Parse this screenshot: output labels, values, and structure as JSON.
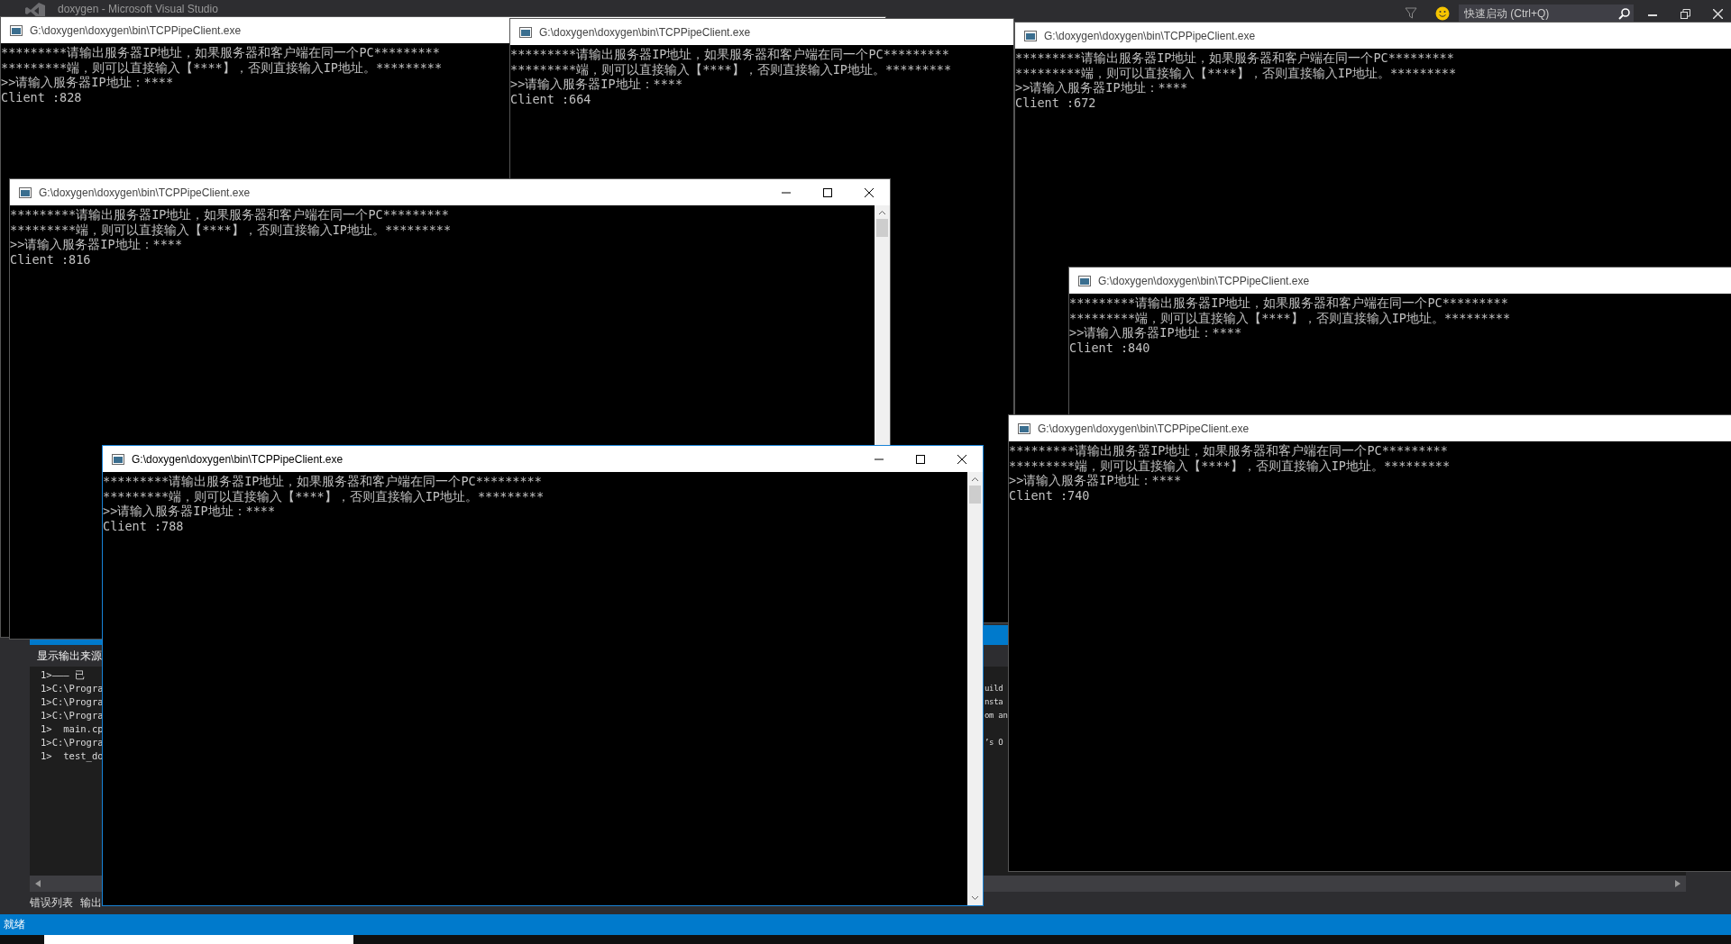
{
  "ide": {
    "title": "doxygen - Microsoft Visual Studio",
    "quick_launch": {
      "placeholder": "快速启动 (Ctrl+Q)"
    },
    "output_pane": {
      "header": "显示输出来源",
      "lines": [
        {
          "left": "1>——— 已"
        },
        {
          "left": "1>C:\\Progra",
          "right": "uild"
        },
        {
          "left": "1>C:\\Progra",
          "right": "nsta"
        },
        {
          "left": "1>C:\\Progra",
          "right": "om an"
        },
        {
          "left": "1>  main.cp"
        },
        {
          "left": "1>C:\\Progra",
          "right": "’s O"
        },
        {
          "left": "1>  test_do"
        }
      ]
    },
    "bottom_tabs": [
      "错误列表",
      "输出"
    ],
    "status_bar": "就绪"
  },
  "console_windows": [
    {
      "title": "G:\\doxygen\\doxygen\\bin\\TCPPipeClient.exe",
      "active": false,
      "lines": [
        "*********请输出服务器IP地址，如果服务器和客户端在同一个PC*********",
        "*********端，则可以直接输入【****】，否则直接输入IP地址。*********",
        ">>请输入服务器IP地址：****",
        "Client :828"
      ]
    },
    {
      "title": "G:\\doxygen\\doxygen\\bin\\TCPPipeClient.exe",
      "active": false,
      "lines": [
        "*********请输出服务器IP地址，如果服务器和客户端在同一个PC*********",
        "*********端，则可以直接输入【****】，否则直接输入IP地址。*********",
        ">>请输入服务器IP地址：****",
        "Client :664"
      ]
    },
    {
      "title": "G:\\doxygen\\doxygen\\bin\\TCPPipeClient.exe",
      "active": false,
      "lines": [
        "*********请输出服务器IP地址，如果服务器和客户端在同一个PC*********",
        "*********端，则可以直接输入【****】，否则直接输入IP地址。*********",
        ">>请输入服务器IP地址：****",
        "Client :672"
      ]
    },
    {
      "title": "G:\\doxygen\\doxygen\\bin\\TCPPipeClient.exe",
      "active": false,
      "lines": [
        "*********请输出服务器IP地址，如果服务器和客户端在同一个PC*********",
        "*********端，则可以直接输入【****】，否则直接输入IP地址。*********",
        ">>请输入服务器IP地址：****",
        "Client :816"
      ]
    },
    {
      "title": "G:\\doxygen\\doxygen\\bin\\TCPPipeClient.exe",
      "active": false,
      "lines": [
        "*********请输出服务器IP地址，如果服务器和客户端在同一个PC*********",
        "*********端，则可以直接输入【****】，否则直接输入IP地址。*********",
        ">>请输入服务器IP地址：****",
        "Client :840"
      ]
    },
    {
      "title": "G:\\doxygen\\doxygen\\bin\\TCPPipeClient.exe",
      "active": false,
      "lines": [
        "*********请输出服务器IP地址，如果服务器和客户端在同一个PC*********",
        "*********端，则可以直接输入【****】，否则直接输入IP地址。*********",
        ">>请输入服务器IP地址：****",
        "Client :740"
      ]
    },
    {
      "title": "G:\\doxygen\\doxygen\\bin\\TCPPipeClient.exe",
      "active": true,
      "lines": [
        "*********请输出服务器IP地址，如果服务器和客户端在同一个PC*********",
        "*********端，则可以直接输入【****】，否则直接输入IP地址。*********",
        ">>请输入服务器IP地址：****",
        "Client :788"
      ]
    }
  ]
}
